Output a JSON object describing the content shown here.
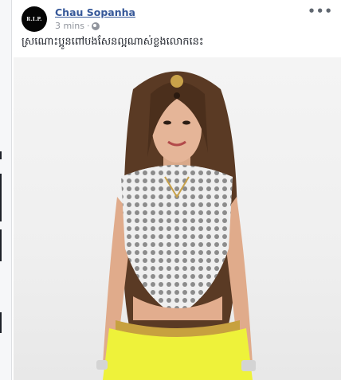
{
  "post": {
    "author": "Chau Sopanha",
    "avatar_text": "R.I.P.",
    "time": "3 mins",
    "separator": "·",
    "text": "ស្រណោះប្អូនពៅបងសែនល្អណាស់ខ្លងលោកនេះ",
    "more_label": "•••",
    "privacy_icon": "globe-icon"
  },
  "photo": {
    "subject": "woman-in-lace-top-photo"
  }
}
